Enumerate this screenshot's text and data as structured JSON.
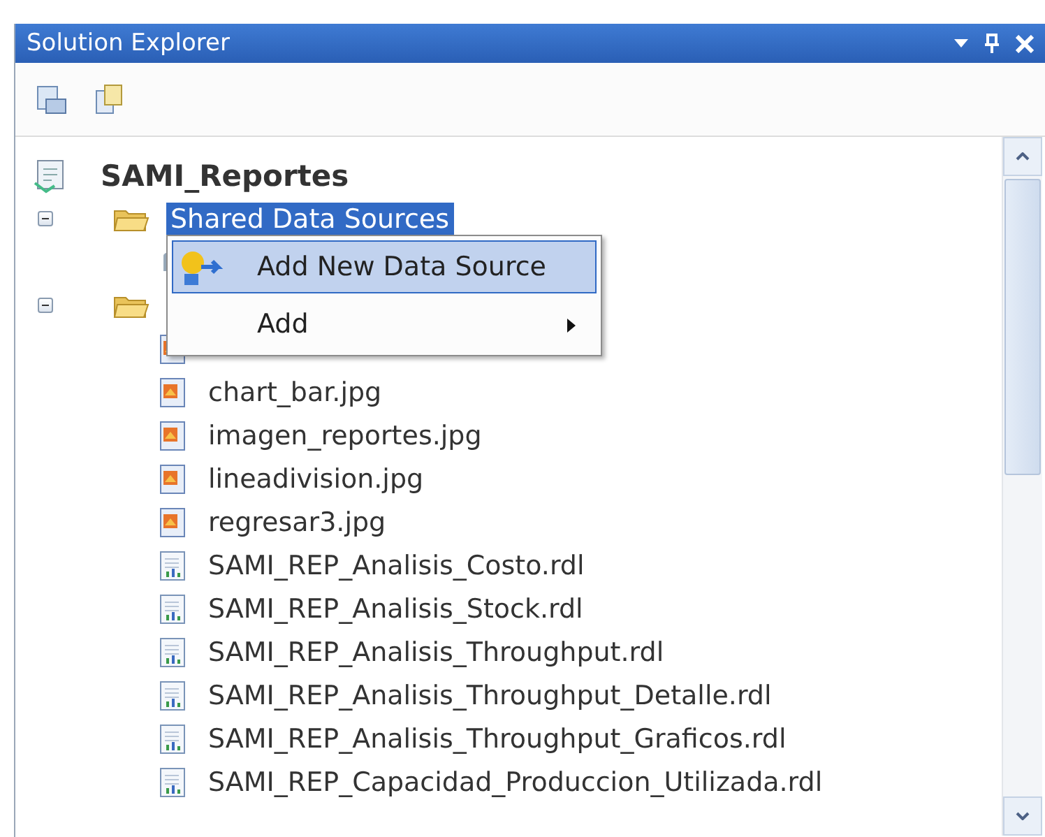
{
  "window": {
    "title": "Solution Explorer"
  },
  "tree": {
    "kind": "project",
    "label": "SAMI_Reportes",
    "selected": false,
    "children": [
      {
        "kind": "folder",
        "label": "Shared Data Sources",
        "expanded": true,
        "selected": true,
        "children": [
          {
            "kind": "datasource"
          }
        ]
      },
      {
        "kind": "folder",
        "expanded": true,
        "children": [
          {
            "kind": "image"
          },
          {
            "kind": "image",
            "label": "chart_bar.jpg",
            "selected": false
          },
          {
            "kind": "image",
            "label": "imagen_reportes.jpg",
            "selected": false
          },
          {
            "kind": "image",
            "label": "lineadivision.jpg",
            "selected": false
          },
          {
            "kind": "image",
            "label": "regresar3.jpg",
            "selected": false
          },
          {
            "kind": "report",
            "label": "SAMI_REP_Analisis_Costo.rdl",
            "selected": false
          },
          {
            "kind": "report",
            "label": "SAMI_REP_Analisis_Stock.rdl",
            "selected": false
          },
          {
            "kind": "report",
            "label": "SAMI_REP_Analisis_Throughput.rdl",
            "selected": false
          },
          {
            "kind": "report",
            "label": "SAMI_REP_Analisis_Throughput_Detalle.rdl",
            "selected": false
          },
          {
            "kind": "report",
            "label": "SAMI_REP_Analisis_Throughput_Graficos.rdl",
            "selected": false
          },
          {
            "kind": "report",
            "label": "SAMI_REP_Capacidad_Produccion_Utilizada.rdl",
            "selected": false
          }
        ]
      }
    ]
  },
  "context_menu": {
    "items": [
      {
        "kind": "command",
        "label": "Add New Data Source",
        "selected": true
      },
      {
        "kind": "submenu",
        "label": "Add",
        "selected": false
      }
    ]
  }
}
